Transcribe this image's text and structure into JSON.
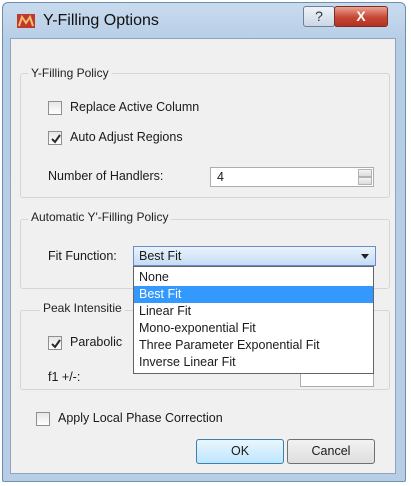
{
  "window": {
    "title": "Y-Filling Options"
  },
  "titlebar": {
    "help_glyph": "?",
    "close_glyph": "X"
  },
  "y_filling_policy": {
    "title": "Y-Filling Policy",
    "replace_active_column": {
      "label": "Replace Active Column",
      "checked": false
    },
    "auto_adjust_regions": {
      "label": "Auto Adjust Regions",
      "checked": true
    },
    "handlers": {
      "label": "Number of Handlers:",
      "value": "4"
    }
  },
  "automatic_policy": {
    "title": "Automatic Y'-Filling Policy",
    "fit_function": {
      "label": "Fit Function:",
      "value": "Best Fit",
      "options": [
        "None",
        "Best Fit",
        "Linear Fit",
        "Mono-exponential Fit",
        "Three Parameter Exponential Fit",
        "Inverse Linear Fit"
      ],
      "highlighted": "Best Fit"
    }
  },
  "peak_intensities": {
    "title": "Peak Intensitie",
    "parabolic": {
      "label": "Parabolic",
      "checked": true
    },
    "f1_label": "f1 +/-:"
  },
  "apply_local_phase_correction": {
    "label": "Apply Local Phase Correction",
    "checked": false
  },
  "buttons": {
    "ok": "OK",
    "cancel": "Cancel"
  },
  "colors": {
    "selection": "#3399ff",
    "title_bar": "#b9cfe7",
    "close_button": "#c74634"
  }
}
